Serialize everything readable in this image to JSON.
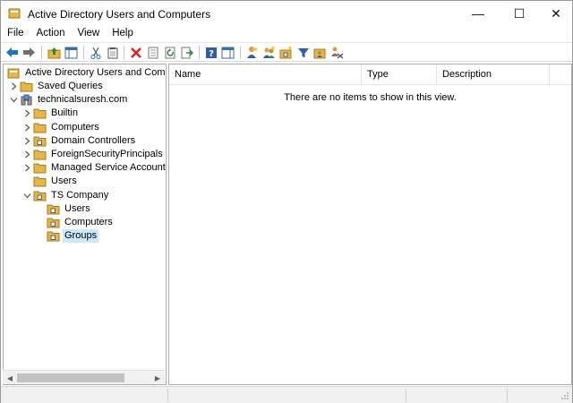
{
  "window": {
    "title": "Active Directory Users and Computers",
    "controls": {
      "minimize": "—",
      "maximize": "☐",
      "close": "✕"
    }
  },
  "menu": [
    "File",
    "Action",
    "View",
    "Help"
  ],
  "toolbar": {
    "buttons": [
      "back-arrow-icon",
      "forward-arrow-icon",
      "up-folder-icon",
      "show-console-tree-icon",
      "cut-icon",
      "copy-icon",
      "delete-icon",
      "properties-icon",
      "refresh-icon",
      "export-list-icon",
      "help-icon",
      "action-pane-icon",
      "new-user-icon",
      "new-group-icon",
      "new-ou-icon",
      "filter-icon",
      "add-to-group-icon",
      "delegate-control-icon"
    ]
  },
  "tree": {
    "root": "Active Directory Users and Computers",
    "items": [
      {
        "label": "Saved Queries",
        "level": 1,
        "expander": "collapsed",
        "icon": "folder"
      },
      {
        "label": "technicalsuresh.com",
        "level": 1,
        "expander": "expanded",
        "icon": "domain"
      },
      {
        "label": "Builtin",
        "level": 2,
        "expander": "collapsed",
        "icon": "folder"
      },
      {
        "label": "Computers",
        "level": 2,
        "expander": "collapsed",
        "icon": "folder"
      },
      {
        "label": "Domain Controllers",
        "level": 2,
        "expander": "collapsed",
        "icon": "ou"
      },
      {
        "label": "ForeignSecurityPrincipals",
        "level": 2,
        "expander": "collapsed",
        "icon": "folder"
      },
      {
        "label": "Managed Service Accounts",
        "level": 2,
        "expander": "collapsed",
        "icon": "folder"
      },
      {
        "label": "Users",
        "level": 2,
        "expander": "none",
        "icon": "folder"
      },
      {
        "label": "TS Company",
        "level": 2,
        "expander": "expanded",
        "icon": "ou"
      },
      {
        "label": "Users",
        "level": 3,
        "expander": "none",
        "icon": "ou"
      },
      {
        "label": "Computers",
        "level": 3,
        "expander": "none",
        "icon": "ou"
      },
      {
        "label": "Groups",
        "level": 3,
        "expander": "none",
        "icon": "ou",
        "selected": true
      }
    ]
  },
  "list": {
    "columns": [
      "Name",
      "Type",
      "Description"
    ],
    "empty_message": "There are no items to show in this view."
  },
  "colors": {
    "selection": "#cce8ff",
    "folder": "#e8b54a",
    "accent_blue": "#1e73be",
    "delete_red": "#d9262b"
  }
}
